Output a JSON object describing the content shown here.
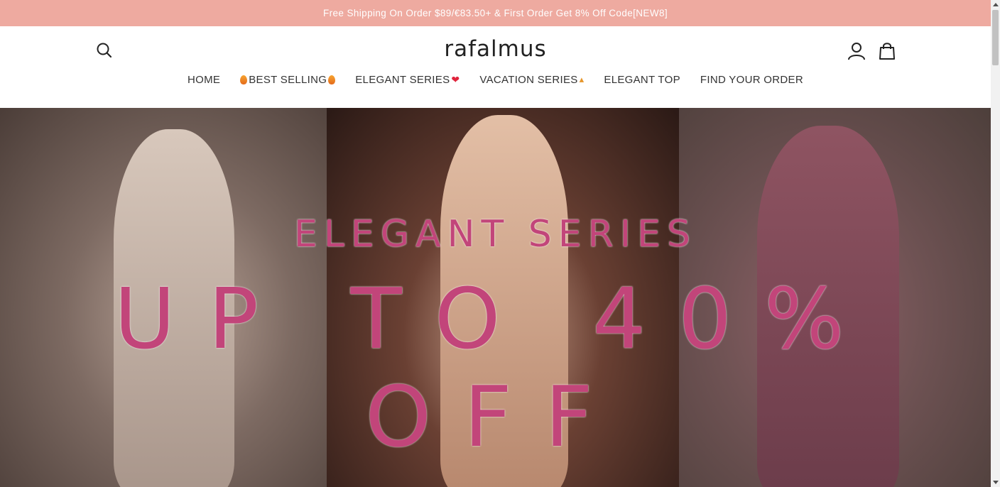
{
  "announcement": "Free Shipping On Order $89/€83.50+  &  First Order Get 8% Off Code[NEW8]",
  "logo": "rafalmus",
  "icons": {
    "search": "search-icon",
    "account": "user-icon",
    "cart": "shopping-bag-icon"
  },
  "nav": {
    "items": [
      {
        "label": "HOME"
      },
      {
        "label": "BEST SELLING",
        "icon": "fire-icon"
      },
      {
        "label": "ELEGANT SERIES",
        "icon": "heart-icon"
      },
      {
        "label": "VACATION SERIES",
        "icon": "party-popper-icon"
      },
      {
        "label": "ELEGANT TOP"
      },
      {
        "label": "FIND YOUR ORDER"
      }
    ]
  },
  "hero": {
    "title": "ELEGANT SERIES",
    "offer": "UP TO 40% OFF"
  },
  "colors": {
    "announcement_bg": "#eeaaa0",
    "hero_text": "#c2457a"
  }
}
